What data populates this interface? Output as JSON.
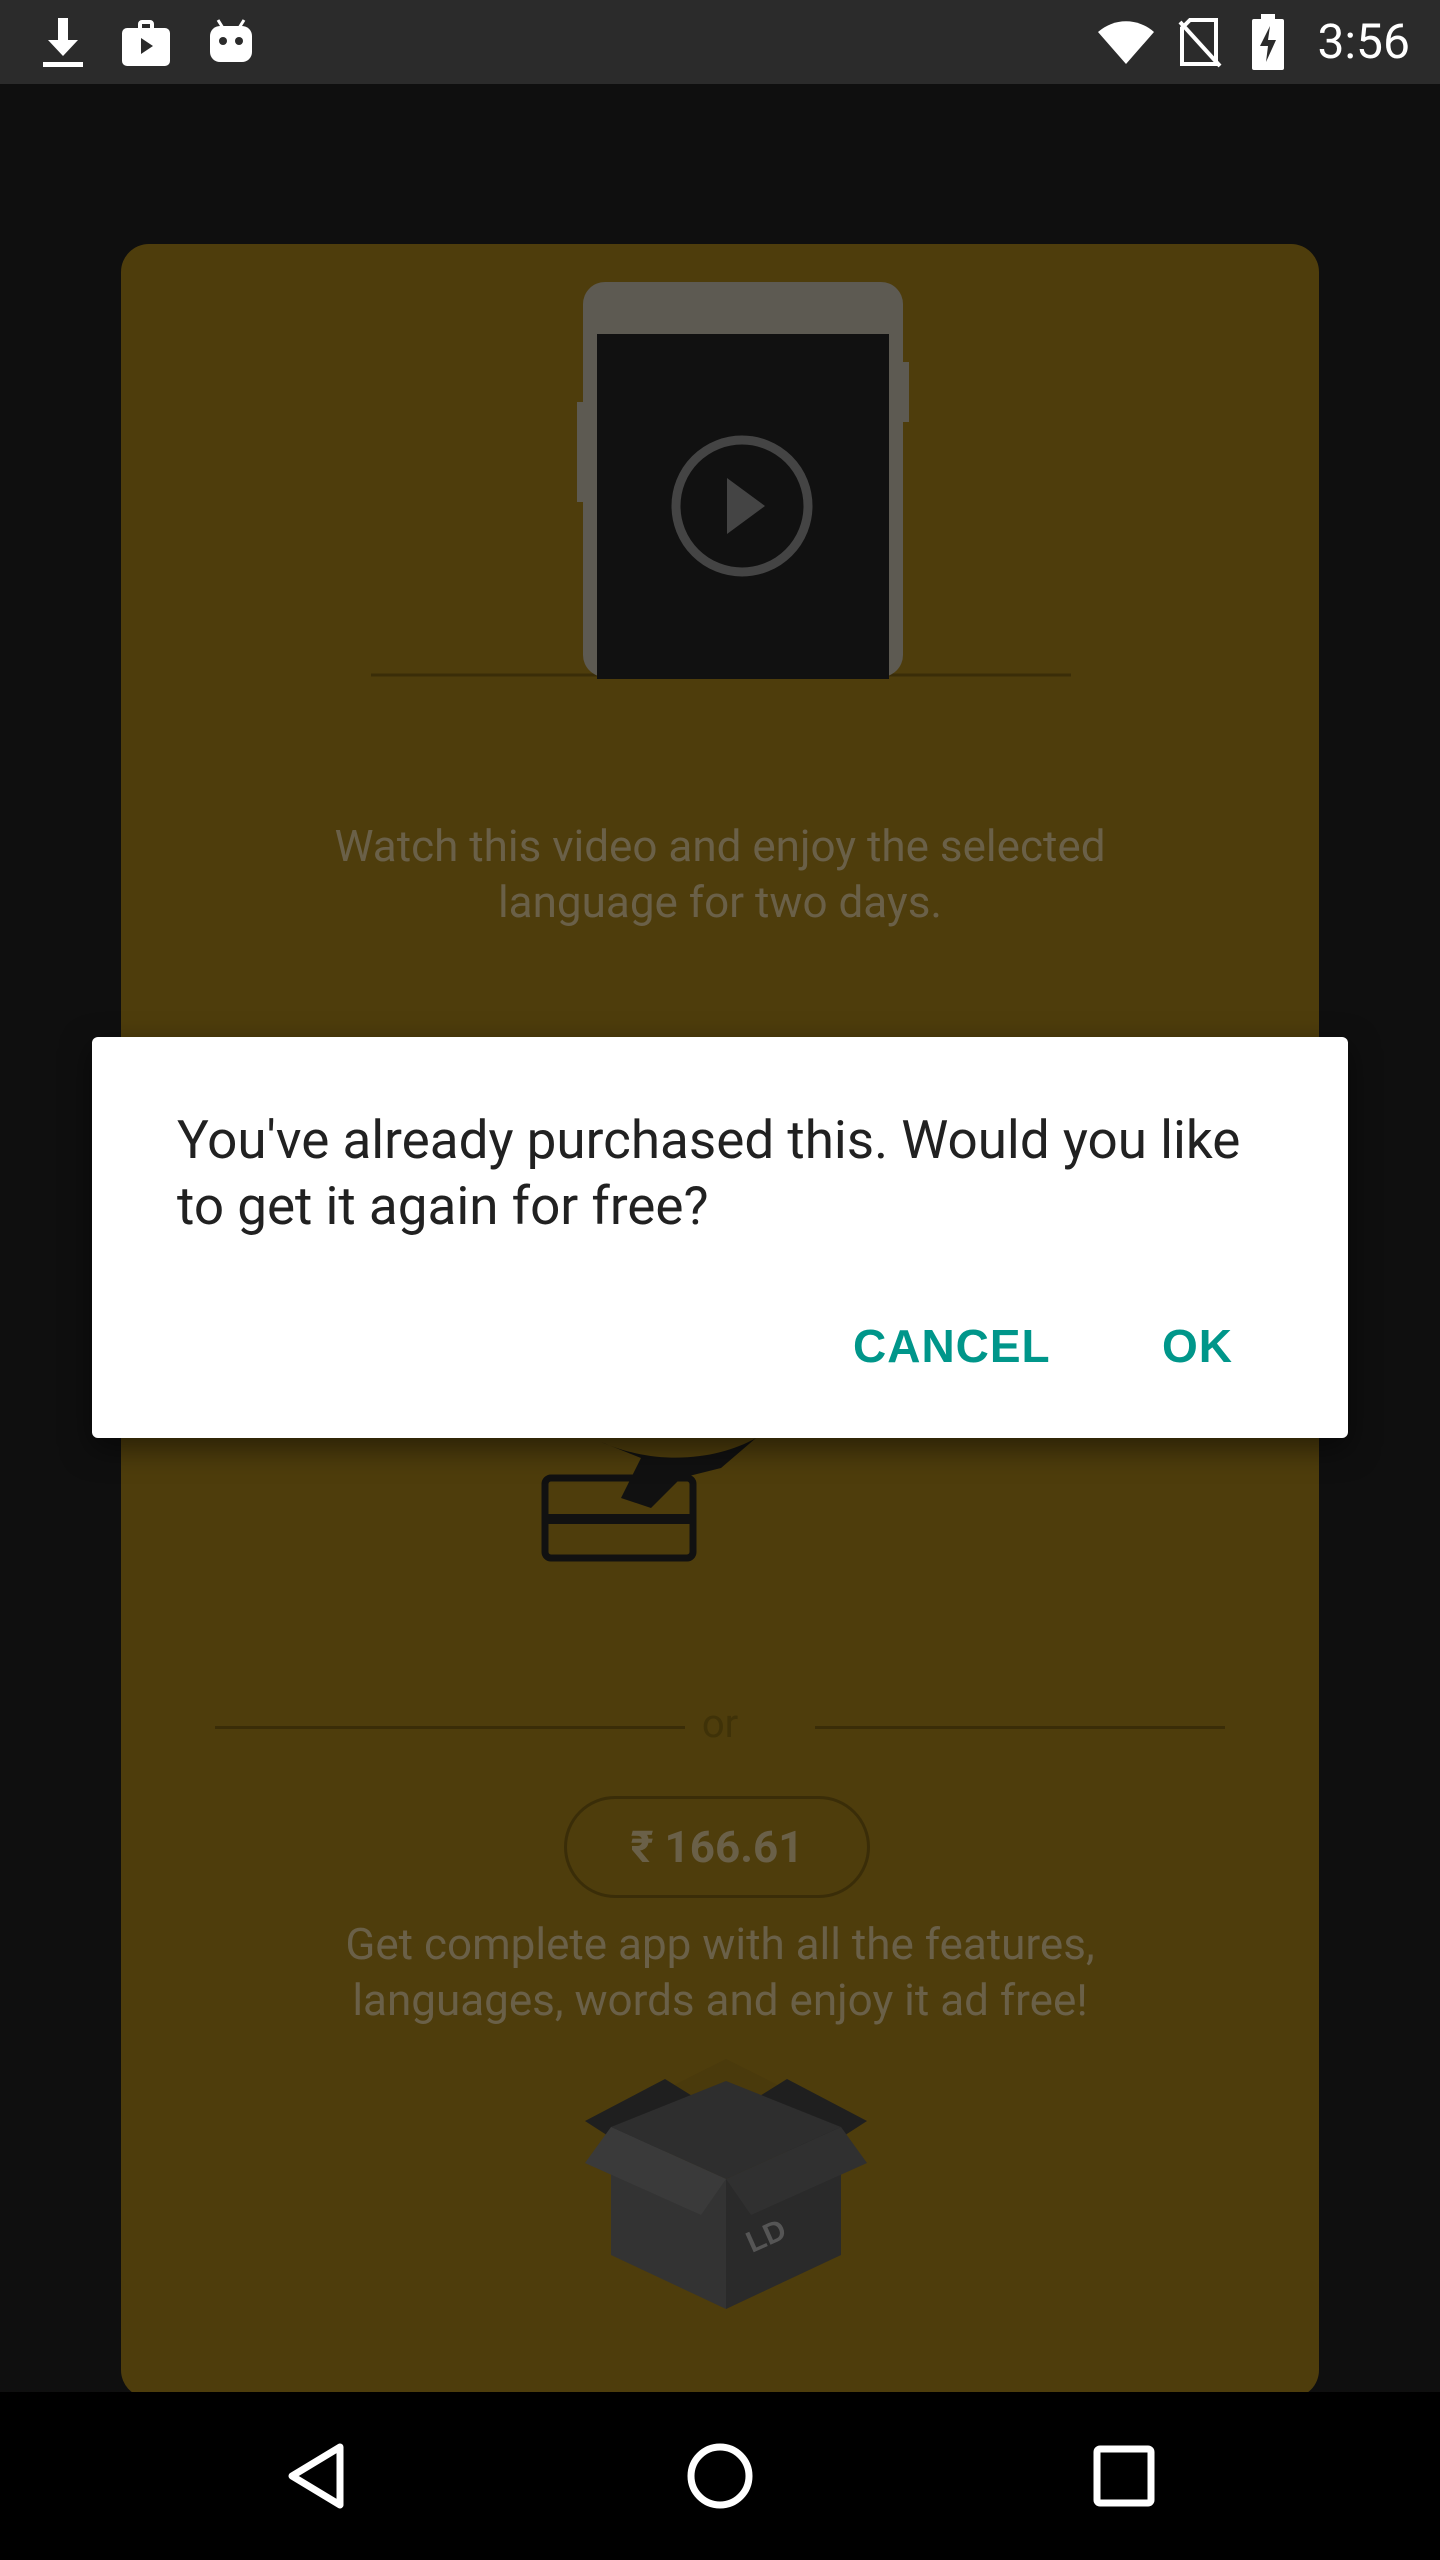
{
  "status_bar": {
    "time": "3:56",
    "left_icons": [
      "download-icon",
      "shopping-bag-icon",
      "android-icon"
    ],
    "right_icons": [
      "wifi-icon",
      "no-sim-icon",
      "battery-charging-icon"
    ]
  },
  "card": {
    "watch_text": "Watch this video and enjoy the selected language for two days.",
    "or_1": "or",
    "or_2": "or",
    "price": "₹ 166.61",
    "full_app_text": "Get complete app with all the features, languages, words and enjoy it ad free!"
  },
  "dialog": {
    "message": "You've already purchased this. Would you like to get it again for free?",
    "cancel_label": "CANCEL",
    "ok_label": "OK",
    "accent_color": "#00968a"
  },
  "nav_bar": {
    "icons": [
      "back-icon",
      "home-icon",
      "recents-icon"
    ]
  }
}
